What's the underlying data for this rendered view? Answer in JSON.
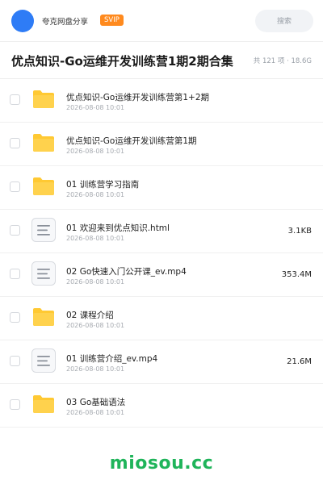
{
  "header": {
    "username": "夸克网盘分享",
    "badge": "SVIP",
    "search_label": "搜索"
  },
  "title": {
    "text": "优点知识-Go运维开发训练营1期2期合集",
    "meta": "共 121 项 · 18.6G"
  },
  "files": [
    {
      "name": "优点知识-Go运维开发训练营第1+2期",
      "date": "2026-08-08 10:01",
      "size": "",
      "type": "folder"
    },
    {
      "name": "优点知识-Go运维开发训练营第1期",
      "date": "2026-08-08 10:01",
      "size": "",
      "type": "folder"
    },
    {
      "name": "01 训练营学习指南",
      "date": "2026-08-08 10:01",
      "size": "",
      "type": "folder"
    },
    {
      "name": "01 欢迎来到优点知识.html",
      "date": "2026-08-08 10:01",
      "size": "3.1KB",
      "type": "document"
    },
    {
      "name": "02 Go快速入门公开课_ev.mp4",
      "date": "2026-08-08 10:01",
      "size": "353.4M",
      "type": "document"
    },
    {
      "name": "02 课程介绍",
      "date": "2026-08-08 10:01",
      "size": "",
      "type": "folder"
    },
    {
      "name": "01 训练营介绍_ev.mp4",
      "date": "2026-08-08 10:01",
      "size": "21.6M",
      "type": "document"
    },
    {
      "name": "03 Go基础语法",
      "date": "2026-08-08 10:01",
      "size": "",
      "type": "folder"
    }
  ],
  "footer": {
    "brand": "miosou.cc"
  },
  "colors": {
    "accent": "#2e7cf6",
    "badge": "#ff8a1e",
    "folder": "#ffc933",
    "brand": "#1fb45a"
  }
}
